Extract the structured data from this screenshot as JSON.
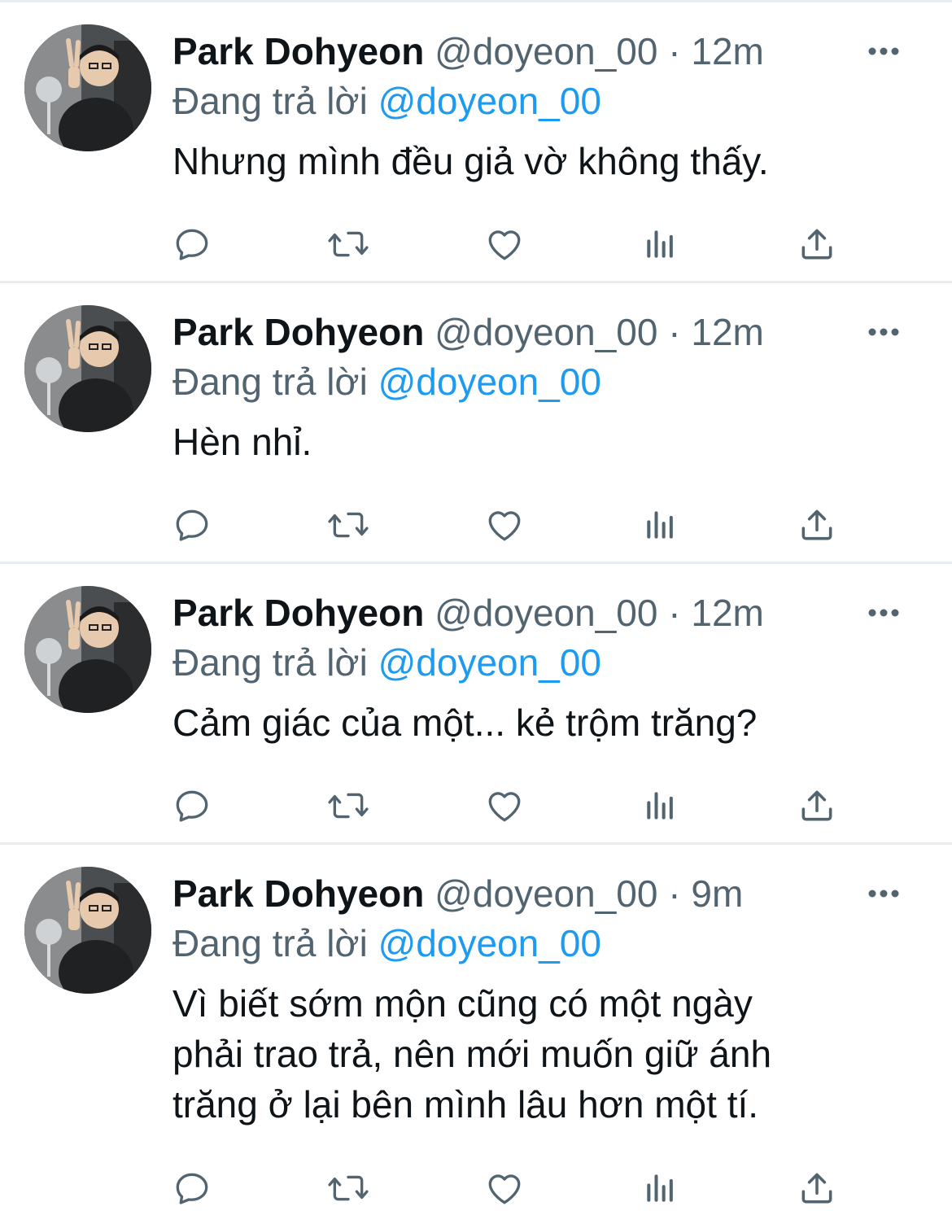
{
  "tweets": [
    {
      "display_name": "Park Dohyeon",
      "handle": "@doyeon_00",
      "separator": "·",
      "time": "12m",
      "reply_prefix": "Đang trả lời",
      "reply_to": "@doyeon_00",
      "text": "Nhưng mình đều giả vờ không thấy."
    },
    {
      "display_name": "Park Dohyeon",
      "handle": "@doyeon_00",
      "separator": "·",
      "time": "12m",
      "reply_prefix": "Đang trả lời",
      "reply_to": "@doyeon_00",
      "text": "Hèn nhỉ."
    },
    {
      "display_name": "Park Dohyeon",
      "handle": "@doyeon_00",
      "separator": "·",
      "time": "12m",
      "reply_prefix": "Đang trả lời",
      "reply_to": "@doyeon_00",
      "text": "Cảm giác của một... kẻ trộm trăng?"
    },
    {
      "display_name": "Park Dohyeon",
      "handle": "@doyeon_00",
      "separator": "·",
      "time": "9m",
      "reply_prefix": "Đang trả lời",
      "reply_to": "@doyeon_00",
      "text": "Vì biết sớm mộn cũng có một ngày\nphải trao trả, nên mới muốn giữ ánh\ntrăng ở lại bên mình lâu hơn một tí."
    }
  ],
  "icons": {
    "more": "more-horizontal-icon",
    "reply": "reply-bubble-icon",
    "retweet": "retweet-icon",
    "like": "heart-icon",
    "views": "views-bar-chart-icon",
    "share": "share-upload-icon"
  },
  "colors": {
    "text_primary": "#0f1419",
    "text_secondary": "#536471",
    "mention_blue": "#1d9bf0",
    "divider": "#e6ecf0"
  }
}
